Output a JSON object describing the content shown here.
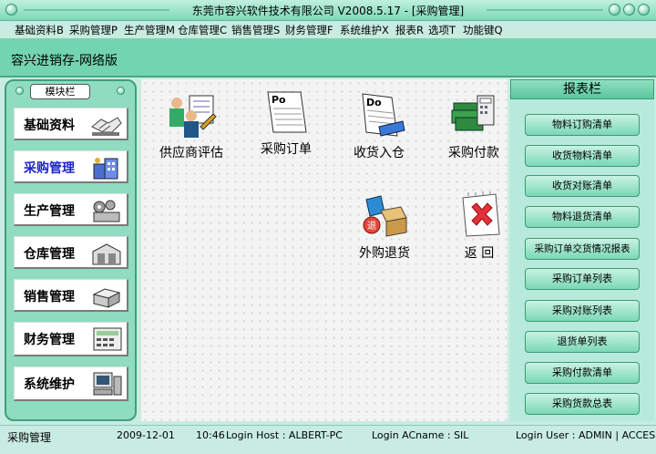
{
  "window": {
    "title": "东莞市容兴软件技术有限公司  V2008.5.17 - [采购管理]"
  },
  "menu": [
    "基础资料B",
    "采购管理P",
    "生产管理M",
    "仓库管理C",
    "销售管理S",
    "财务管理F",
    "系统维护X",
    "报表R",
    "选项T",
    "功能键Q"
  ],
  "app": {
    "title": "容兴进销存-网络版"
  },
  "modules": {
    "title": "模块栏",
    "items": [
      {
        "label": "基础资料",
        "icon": "handshake-icon",
        "active": false
      },
      {
        "label": "采购管理",
        "icon": "purchase-building-icon",
        "active": true
      },
      {
        "label": "生产管理",
        "icon": "factory-gears-icon",
        "active": false
      },
      {
        "label": "仓库管理",
        "icon": "warehouse-icon",
        "active": false
      },
      {
        "label": "销售管理",
        "icon": "sales-box-icon",
        "active": false
      },
      {
        "label": "财务管理",
        "icon": "calculator-icon",
        "active": false
      },
      {
        "label": "系统维护",
        "icon": "computer-icon",
        "active": false
      }
    ]
  },
  "workspace": {
    "buttons": [
      {
        "label": "供应商评估",
        "icon": "supplier-eval-icon"
      },
      {
        "label": "采购订单",
        "icon": "po-document-icon"
      },
      {
        "label": "收货入仓",
        "icon": "do-document-icon"
      },
      {
        "label": "采购付款",
        "icon": "payment-icon"
      },
      {
        "label": "外购退货",
        "icon": "return-goods-icon"
      },
      {
        "label": "返  回",
        "icon": "back-icon"
      }
    ],
    "doc_po": "Po",
    "doc_do": "Do",
    "return_badge": "退"
  },
  "reports": {
    "title": "报表栏",
    "items": [
      "物料订购清单",
      "收货物料清单",
      "收货对账清单",
      "物料退货清单",
      "采购订单交货情况报表",
      "采购订单列表",
      "采购对账列表",
      "退货单列表",
      "采购付款清单",
      "采购货款总表"
    ]
  },
  "status": {
    "module": "采购管理",
    "date": "2009-12-01",
    "time": "10:46",
    "host": "Login Host : ALBERT-PC",
    "acname": "Login ACname : SIL",
    "user": "Login User : ADMIN | ACCESS"
  },
  "colors": {
    "accent": "#73d4b1",
    "active_module": "#1b24c8",
    "panel": "#8fdcc0"
  }
}
